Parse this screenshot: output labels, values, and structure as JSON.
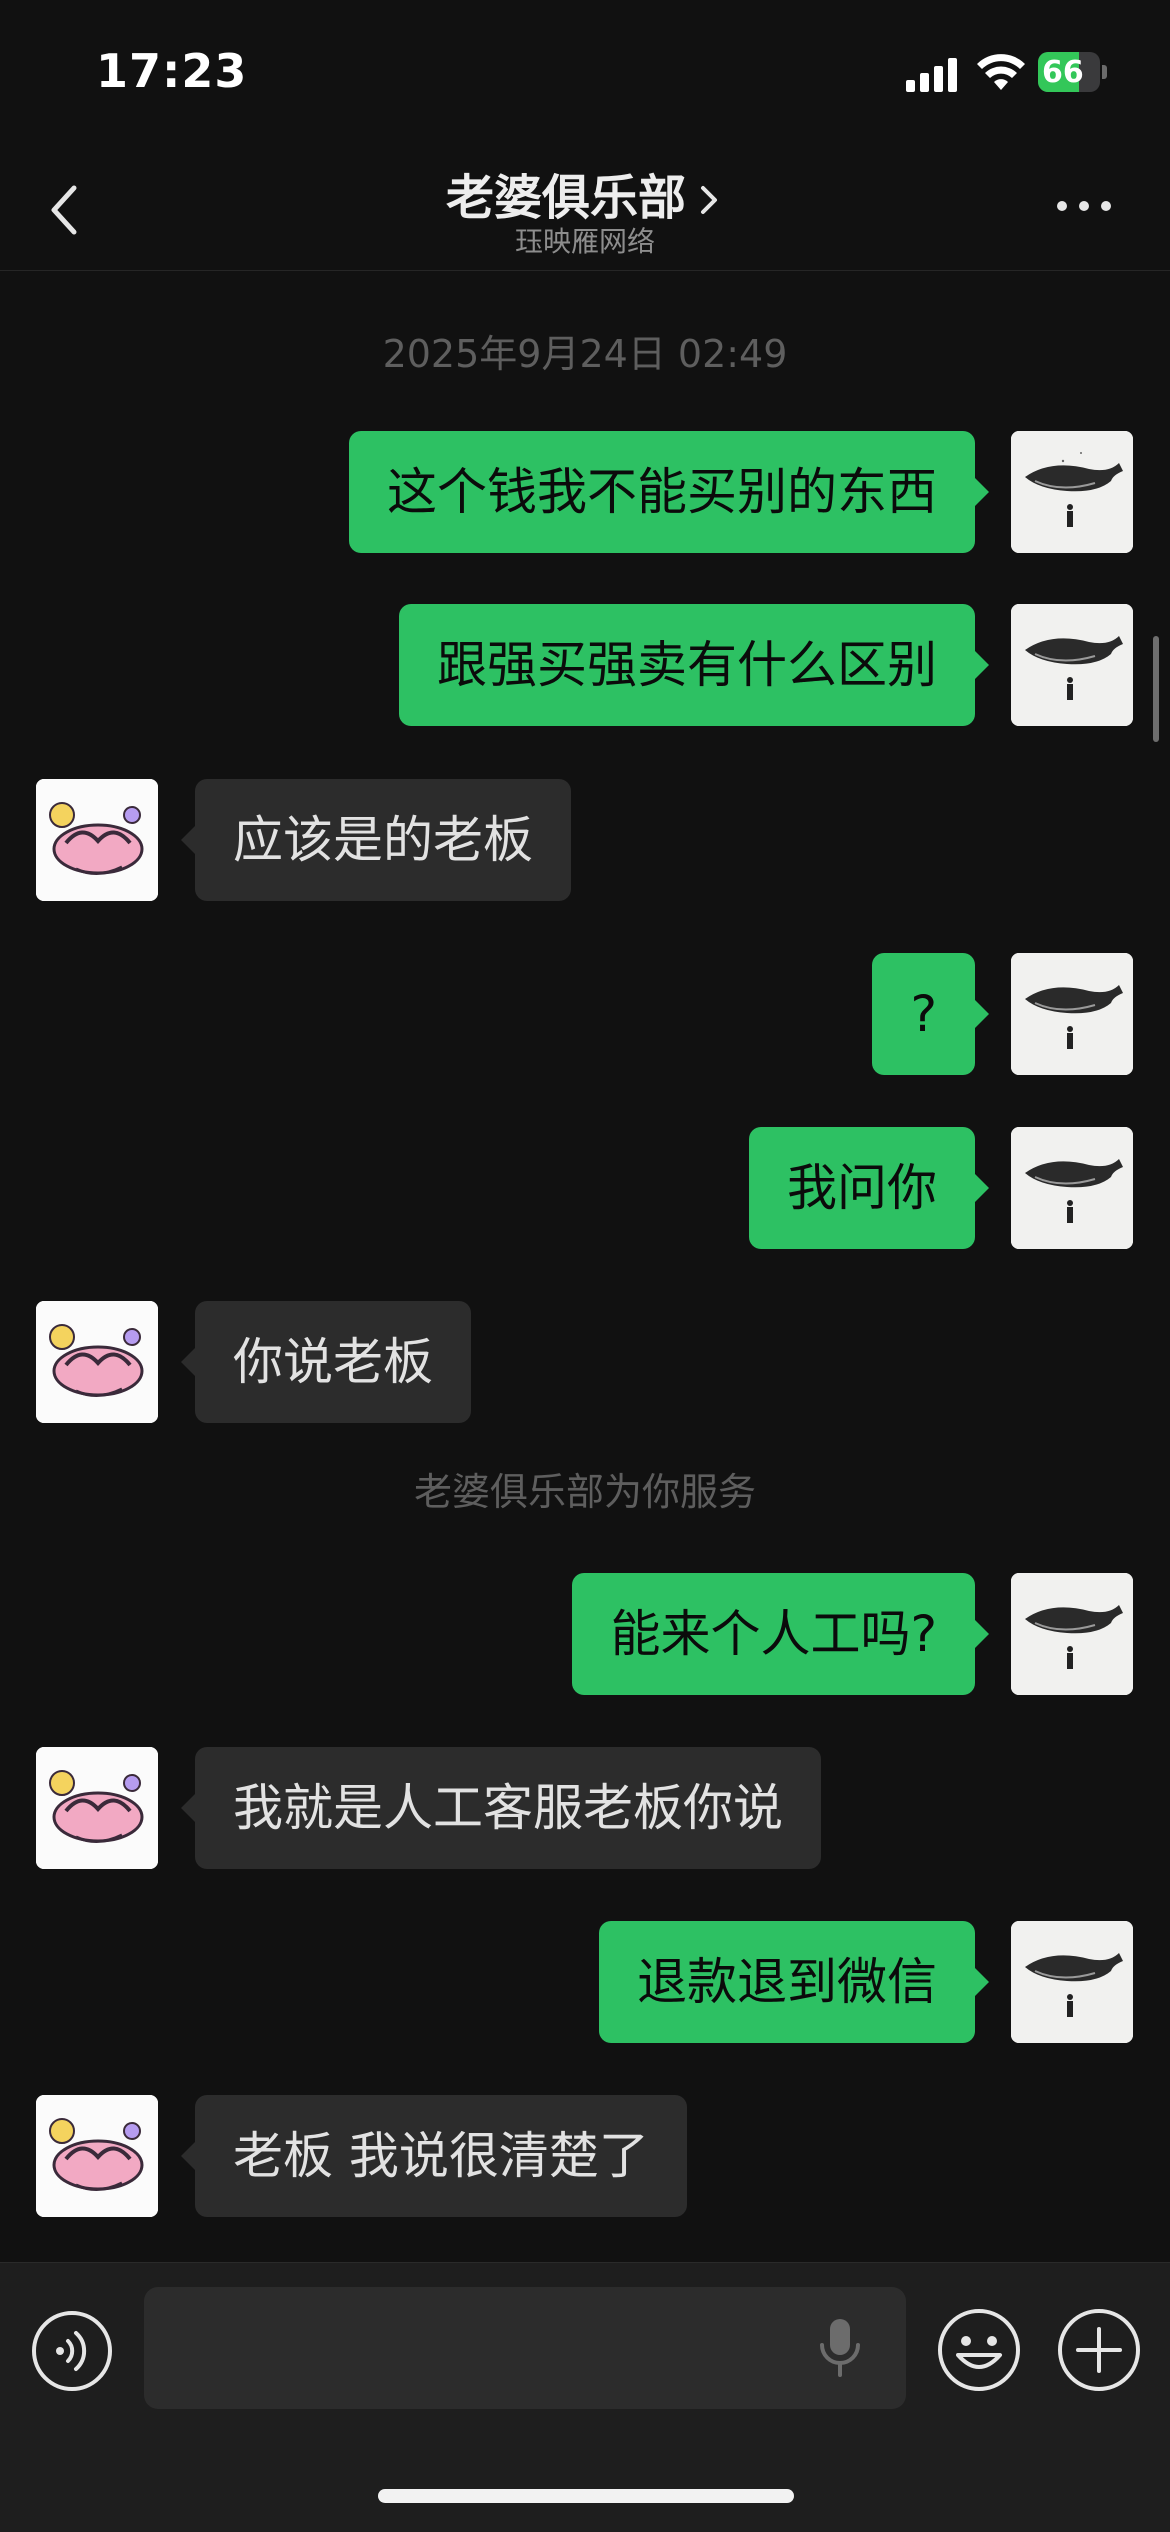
{
  "status_bar": {
    "time": "17:23",
    "battery": "66",
    "battery_level": 0.66
  },
  "nav": {
    "title": "老婆俱乐部",
    "subtitle": "珏映雁网络"
  },
  "chat": {
    "timestamp": "2025年9月24日 02:49",
    "system_note": "老婆俱乐部为你服务",
    "messages": [
      {
        "sender": "me",
        "text": "这个钱我不能买别的东西"
      },
      {
        "sender": "me",
        "text": "跟强买强卖有什么区别"
      },
      {
        "sender": "other",
        "text": "应该是的老板"
      },
      {
        "sender": "me",
        "text": "?"
      },
      {
        "sender": "me",
        "text": "我问你"
      },
      {
        "sender": "other",
        "text": "你说老板"
      },
      {
        "sender": "me",
        "text": "能来个人工吗?"
      },
      {
        "sender": "other",
        "text": "我就是人工客服老板你说"
      },
      {
        "sender": "me",
        "text": "退款退到微信"
      },
      {
        "sender": "other",
        "text": "老板 我说很清楚了"
      }
    ]
  },
  "input": {
    "value": "",
    "placeholder": ""
  },
  "icons": {
    "back": "chevron-left-icon",
    "title_arrow": "chevron-right-icon",
    "more": "more-dots-icon",
    "voice": "voice-wave-icon",
    "mic": "microphone-icon",
    "emoji": "emoji-face-icon",
    "plus": "plus-circle-icon"
  },
  "colors": {
    "background": "#111111",
    "my_bubble": "#2dc163",
    "other_bubble": "#2c2c2c",
    "battery": "#33c759"
  }
}
